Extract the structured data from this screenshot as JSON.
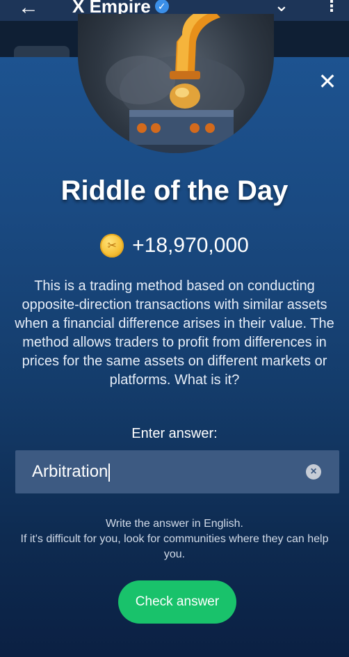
{
  "app_bar": {
    "title": "X Empire",
    "back_icon": "←",
    "verified_icon": "✓",
    "chevron_icon": "⌄",
    "more_icon": "⋮"
  },
  "modal": {
    "close_icon": "✕",
    "title": "Riddle of the Day",
    "reward": "+18,970,000",
    "riddle_text": "This is a trading method based on conducting opposite-direction transactions with similar assets when a financial difference arises in their value. The method allows traders to profit from differences in prices for the same assets on different markets or platforms. What is it?",
    "answer_label": "Enter answer:",
    "answer_value": "Arbitration",
    "clear_icon": "×",
    "hint_line1": "Write the answer in English.",
    "hint_line2": "If it's difficult for you, look for communities where they can help you.",
    "check_button": "Check answer"
  },
  "colors": {
    "accent_green": "#19c26b",
    "coin_gold": "#f7c23a",
    "input_bg": "#3d5a82"
  }
}
